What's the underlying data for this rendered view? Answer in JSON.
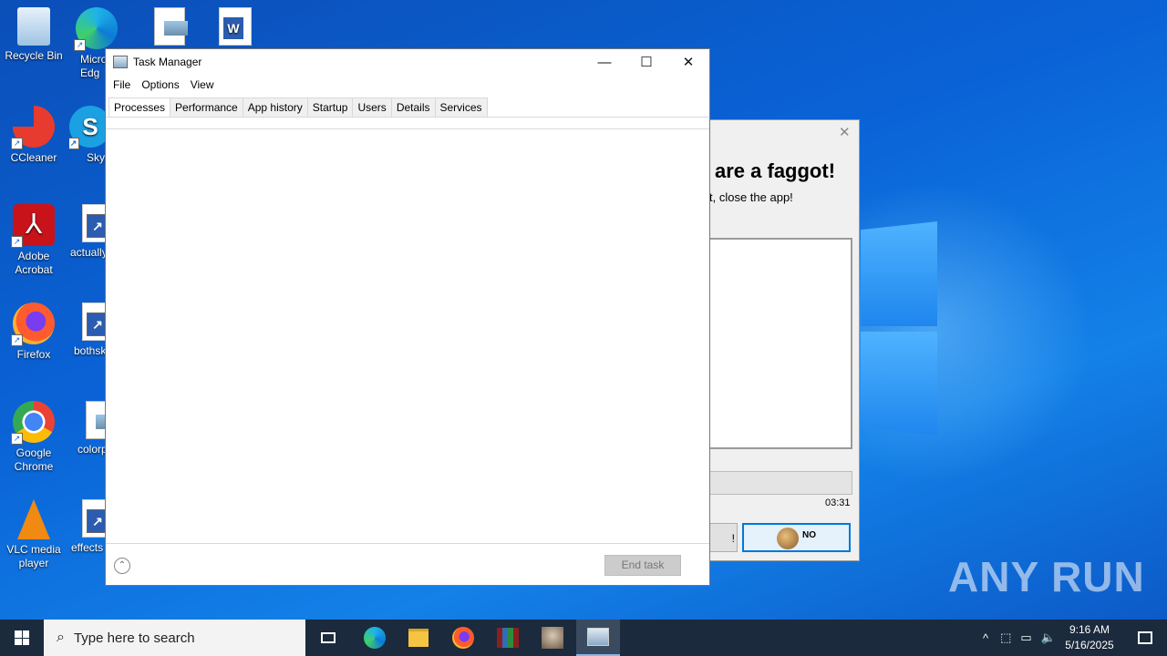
{
  "desktop": {
    "icons": [
      {
        "label": "Recycle Bin"
      },
      {
        "label": "Micro Edg"
      },
      {
        "label": ""
      },
      {
        "label": ""
      },
      {
        "label": "CCleaner"
      },
      {
        "label": "Sky"
      },
      {
        "label": "Adobe Acrobat"
      },
      {
        "label": "actually"
      },
      {
        "label": "Firefox"
      },
      {
        "label": "bothsk"
      },
      {
        "label": "Google Chrome"
      },
      {
        "label": "colorp"
      },
      {
        "label": "VLC media player"
      },
      {
        "label": "effects"
      }
    ],
    "watermark": "ANY RUN"
  },
  "task_manager": {
    "title": "Task Manager",
    "controls": {
      "minimize": "—",
      "maximize": "☐",
      "close": "✕"
    },
    "menu": [
      "File",
      "Options",
      "View"
    ],
    "tabs": [
      "Processes",
      "Performance",
      "App history",
      "Startup",
      "Users",
      "Details",
      "Services"
    ],
    "active_tab": "Processes",
    "fewer_details_glyph": "⌃",
    "end_task_label": "End task"
  },
  "prank_window": {
    "close_glyph": "✕",
    "heading": "are a faggot!",
    "subtext": "t, close the app!",
    "timer": "03:31",
    "left_button": "!",
    "right_button_text": "NO"
  },
  "taskbar": {
    "search_placeholder": "Type here to search",
    "clock_time": "9:16 AM",
    "clock_date": "5/16/2025",
    "accent": "#1b2a3c"
  }
}
